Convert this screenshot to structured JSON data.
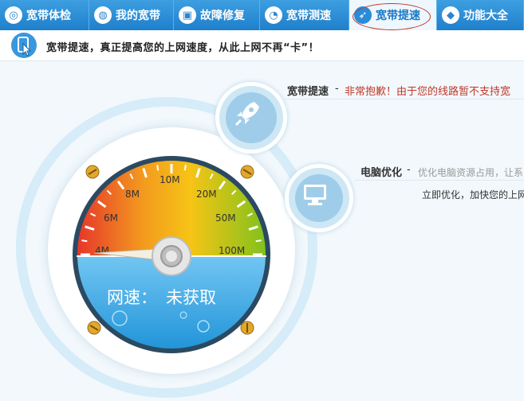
{
  "tabs": [
    {
      "label": "宽带体检",
      "icon": "target-icon"
    },
    {
      "label": "我的宽带",
      "icon": "globe-icon"
    },
    {
      "label": "故障修复",
      "icon": "toolbox-icon"
    },
    {
      "label": "宽带测速",
      "icon": "speedometer-icon"
    },
    {
      "label": "宽带提速",
      "icon": "rocket-icon",
      "active": true
    },
    {
      "label": "功能大全",
      "icon": "cube-icon"
    }
  ],
  "info": {
    "text": "宽带提速，真正提高您的上网速度，从此上网不再“卡”！"
  },
  "speed": {
    "title": "宽带提速",
    "dash": "-",
    "note": "非常抱歉！由于您的线路暂不支持宽"
  },
  "optimize": {
    "title": "电脑优化",
    "dash": "-",
    "note": "优化电脑资源占用，让系",
    "hint": "立即优化，加快您的上网"
  },
  "gauge": {
    "ticks": [
      "4M",
      "6M",
      "8M",
      "10M",
      "20M",
      "50M",
      "100M"
    ],
    "status_label": "网速：",
    "status_value": "未获取"
  },
  "colors": {
    "tab_bg": "#1f7fcc",
    "active_tab_bg": "#eef7fd",
    "red_note": "#c0392b"
  }
}
